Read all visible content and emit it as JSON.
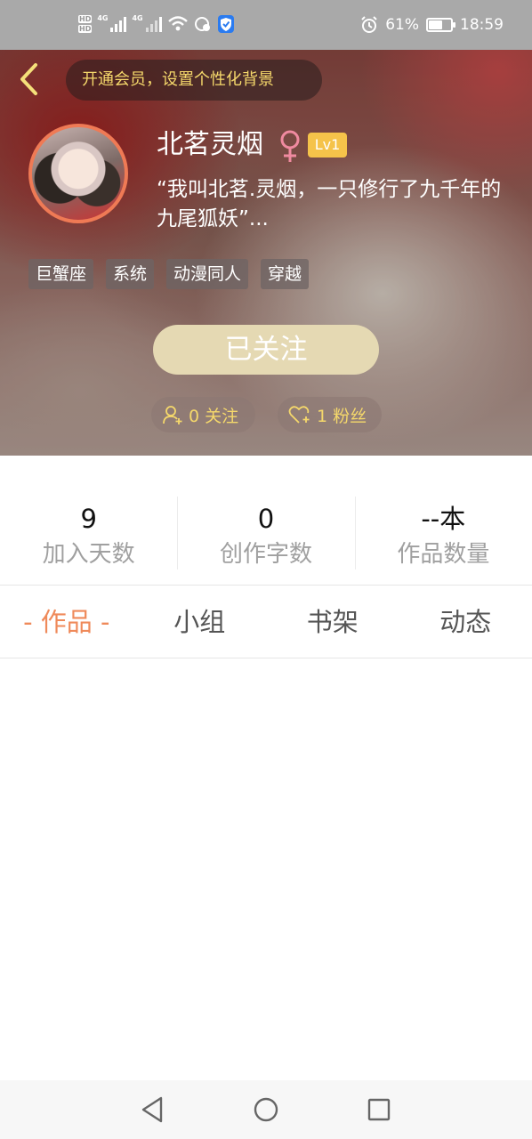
{
  "status_bar": {
    "hd1": "HD",
    "hd2": "HD",
    "net1": "4G",
    "net2": "4G",
    "battery_percent": "61%",
    "battery_level": 0.61,
    "time": "18:59"
  },
  "header": {
    "vip_banner": "开通会员，设置个性化背景",
    "username": "北茗灵烟",
    "gender_symbol": "♀",
    "level": "Lv1",
    "bio": "“我叫北茗.灵烟，一只修行了九千年的九尾狐妖”...",
    "tags": [
      "巨蟹座",
      "系统",
      "动漫同人",
      "穿越"
    ],
    "follow_button": "已关注",
    "following_label": "0 关注",
    "fans_label": "1 粉丝"
  },
  "stats": [
    {
      "value": "9",
      "label": "加入天数"
    },
    {
      "value": "0",
      "label": "创作字数"
    },
    {
      "value": "--本",
      "label": "作品数量"
    }
  ],
  "tabs": [
    {
      "label": "- 作品 -",
      "active": true
    },
    {
      "label": "小组",
      "active": false
    },
    {
      "label": "书架",
      "active": false
    },
    {
      "label": "动态",
      "active": false
    }
  ],
  "colors": {
    "accent": "#ef8a5a",
    "banner_text": "#f5d86b",
    "level_badge": "#f5c34a",
    "follow_button": "#e5d9b3"
  }
}
